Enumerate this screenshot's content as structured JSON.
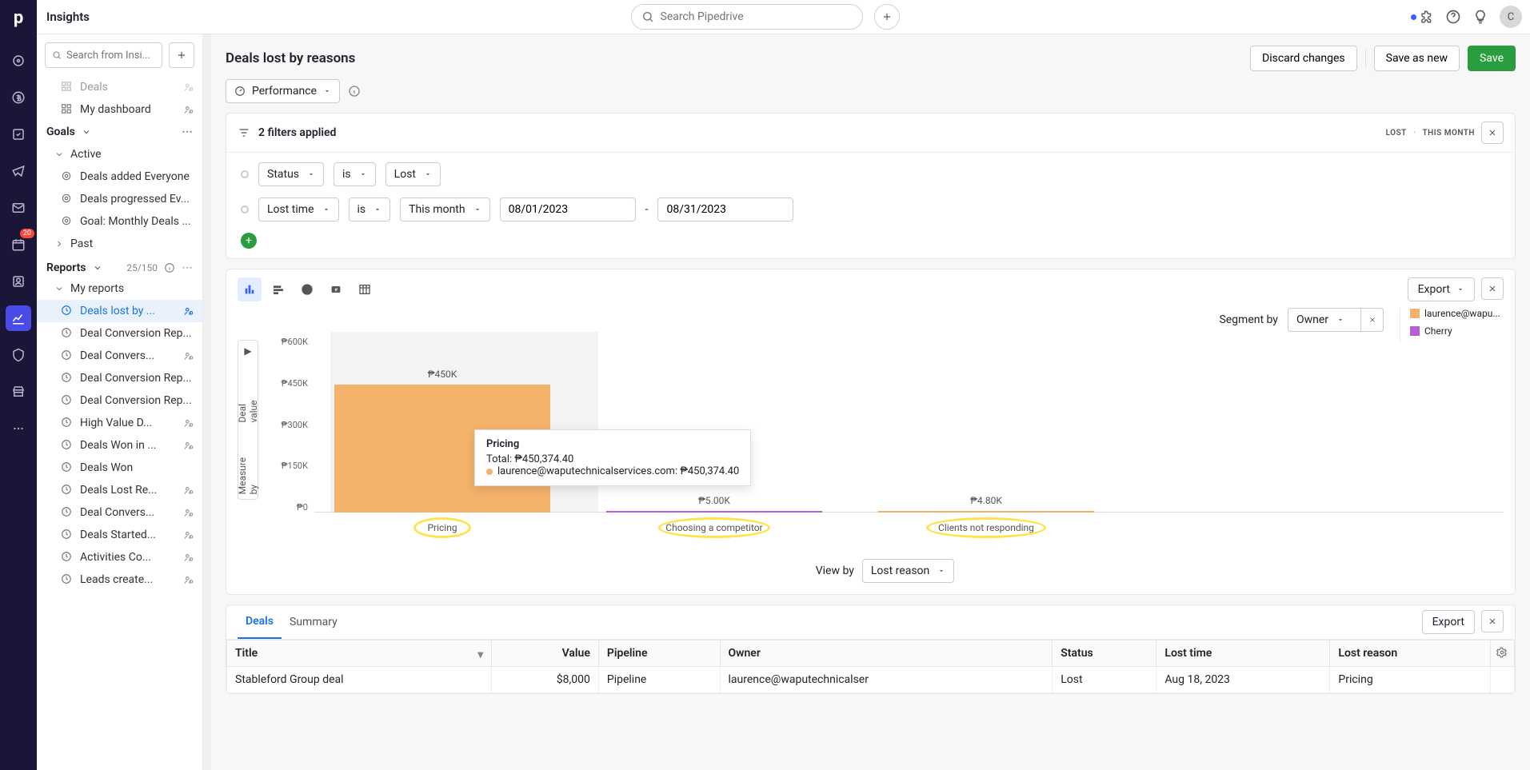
{
  "header": {
    "title": "Insights",
    "search_placeholder": "Search Pipedrive",
    "avatar_initial": "C",
    "activity_badge": "20"
  },
  "sidebar": {
    "search_placeholder": "Search from Insi...",
    "top_items": [
      {
        "label": "Deals",
        "shared": true
      },
      {
        "label": "My dashboard",
        "shared": true
      }
    ],
    "goals_label": "Goals",
    "active_label": "Active",
    "past_label": "Past",
    "goals_items": [
      {
        "label": "Deals added Everyone"
      },
      {
        "label": "Deals progressed Ev..."
      },
      {
        "label": "Goal: Monthly Deals ..."
      }
    ],
    "reports_label": "Reports",
    "reports_count": "25/150",
    "my_reports_label": "My reports",
    "reports_items": [
      {
        "label": "Deals lost by ...",
        "shared": true,
        "selected": true
      },
      {
        "label": "Deal Conversion Rep...",
        "shared": false
      },
      {
        "label": "Deal Convers...",
        "shared": true
      },
      {
        "label": "Deal Conversion Rep...",
        "shared": false
      },
      {
        "label": "Deal Conversion Rep...",
        "shared": false
      },
      {
        "label": "High Value D...",
        "shared": true
      },
      {
        "label": "Deals Won in ...",
        "shared": true
      },
      {
        "label": "Deals Won",
        "shared": false
      },
      {
        "label": "Deals Lost Re...",
        "shared": true
      },
      {
        "label": "Deal Convers...",
        "shared": true
      },
      {
        "label": "Deals Started...",
        "shared": true
      },
      {
        "label": "Activities Co...",
        "shared": true
      },
      {
        "label": "Leads create...",
        "shared": true
      }
    ]
  },
  "page": {
    "title": "Deals lost by reasons",
    "discard": "Discard changes",
    "save_as_new": "Save as new",
    "save": "Save",
    "performance_label": "Performance"
  },
  "filters": {
    "applied_label": "2 filters applied",
    "tag1": "LOST",
    "tag2": "THIS MONTH",
    "line1": {
      "field": "Status",
      "op": "is",
      "value": "Lost"
    },
    "line2": {
      "field": "Lost time",
      "op": "is",
      "period": "This month",
      "date_from": "08/01/2023",
      "date_to": "08/31/2023"
    }
  },
  "chart_data": {
    "type": "bar",
    "title": "",
    "ylabel": "Deal value",
    "xlabel": "Lost reason",
    "y_ticks": [
      "₱600K",
      "₱450K",
      "₱300K",
      "₱150K",
      "₱0"
    ],
    "ylim": [
      0,
      600000
    ],
    "categories": [
      "Pricing",
      "Choosing a competitor",
      "Clients not responding"
    ],
    "series": [
      {
        "name": "laurence@waputechnicalservices.com",
        "color": "#f4b26b",
        "values": [
          450374.4,
          0,
          4800
        ]
      },
      {
        "name": "Cherry",
        "color": "#b95dd6",
        "values": [
          0,
          5000,
          0
        ]
      }
    ],
    "bar_display_values": [
      "₱450K",
      "₱5.00K",
      "₱4.80K"
    ],
    "segment_by_label": "Segment by",
    "segment_by_value": "Owner",
    "view_by_label": "View by",
    "view_by_value": "Lost reason",
    "measure_by_label": "Measure by",
    "export_label": "Export",
    "tooltip": {
      "title": "Pricing",
      "total_label": "Total: ₱450,374.40",
      "row": "laurence@waputechnicalservices.com: ₱450,374.40"
    },
    "legend": [
      {
        "label": "laurence@wapu...",
        "color": "#f4b26b"
      },
      {
        "label": "Cherry",
        "color": "#b95dd6"
      }
    ]
  },
  "table": {
    "tabs": {
      "deals": "Deals",
      "summary": "Summary"
    },
    "export_label": "Export",
    "columns": [
      "Title",
      "Value",
      "Pipeline",
      "Owner",
      "Status",
      "Lost time",
      "Lost reason"
    ],
    "rows": [
      {
        "title": "Stableford Group deal",
        "value": "$8,000",
        "pipeline": "Pipeline",
        "owner": "laurence@waputechnicalser",
        "status": "Lost",
        "lost_time": "Aug 18, 2023",
        "lost_reason": "Pricing"
      }
    ]
  }
}
